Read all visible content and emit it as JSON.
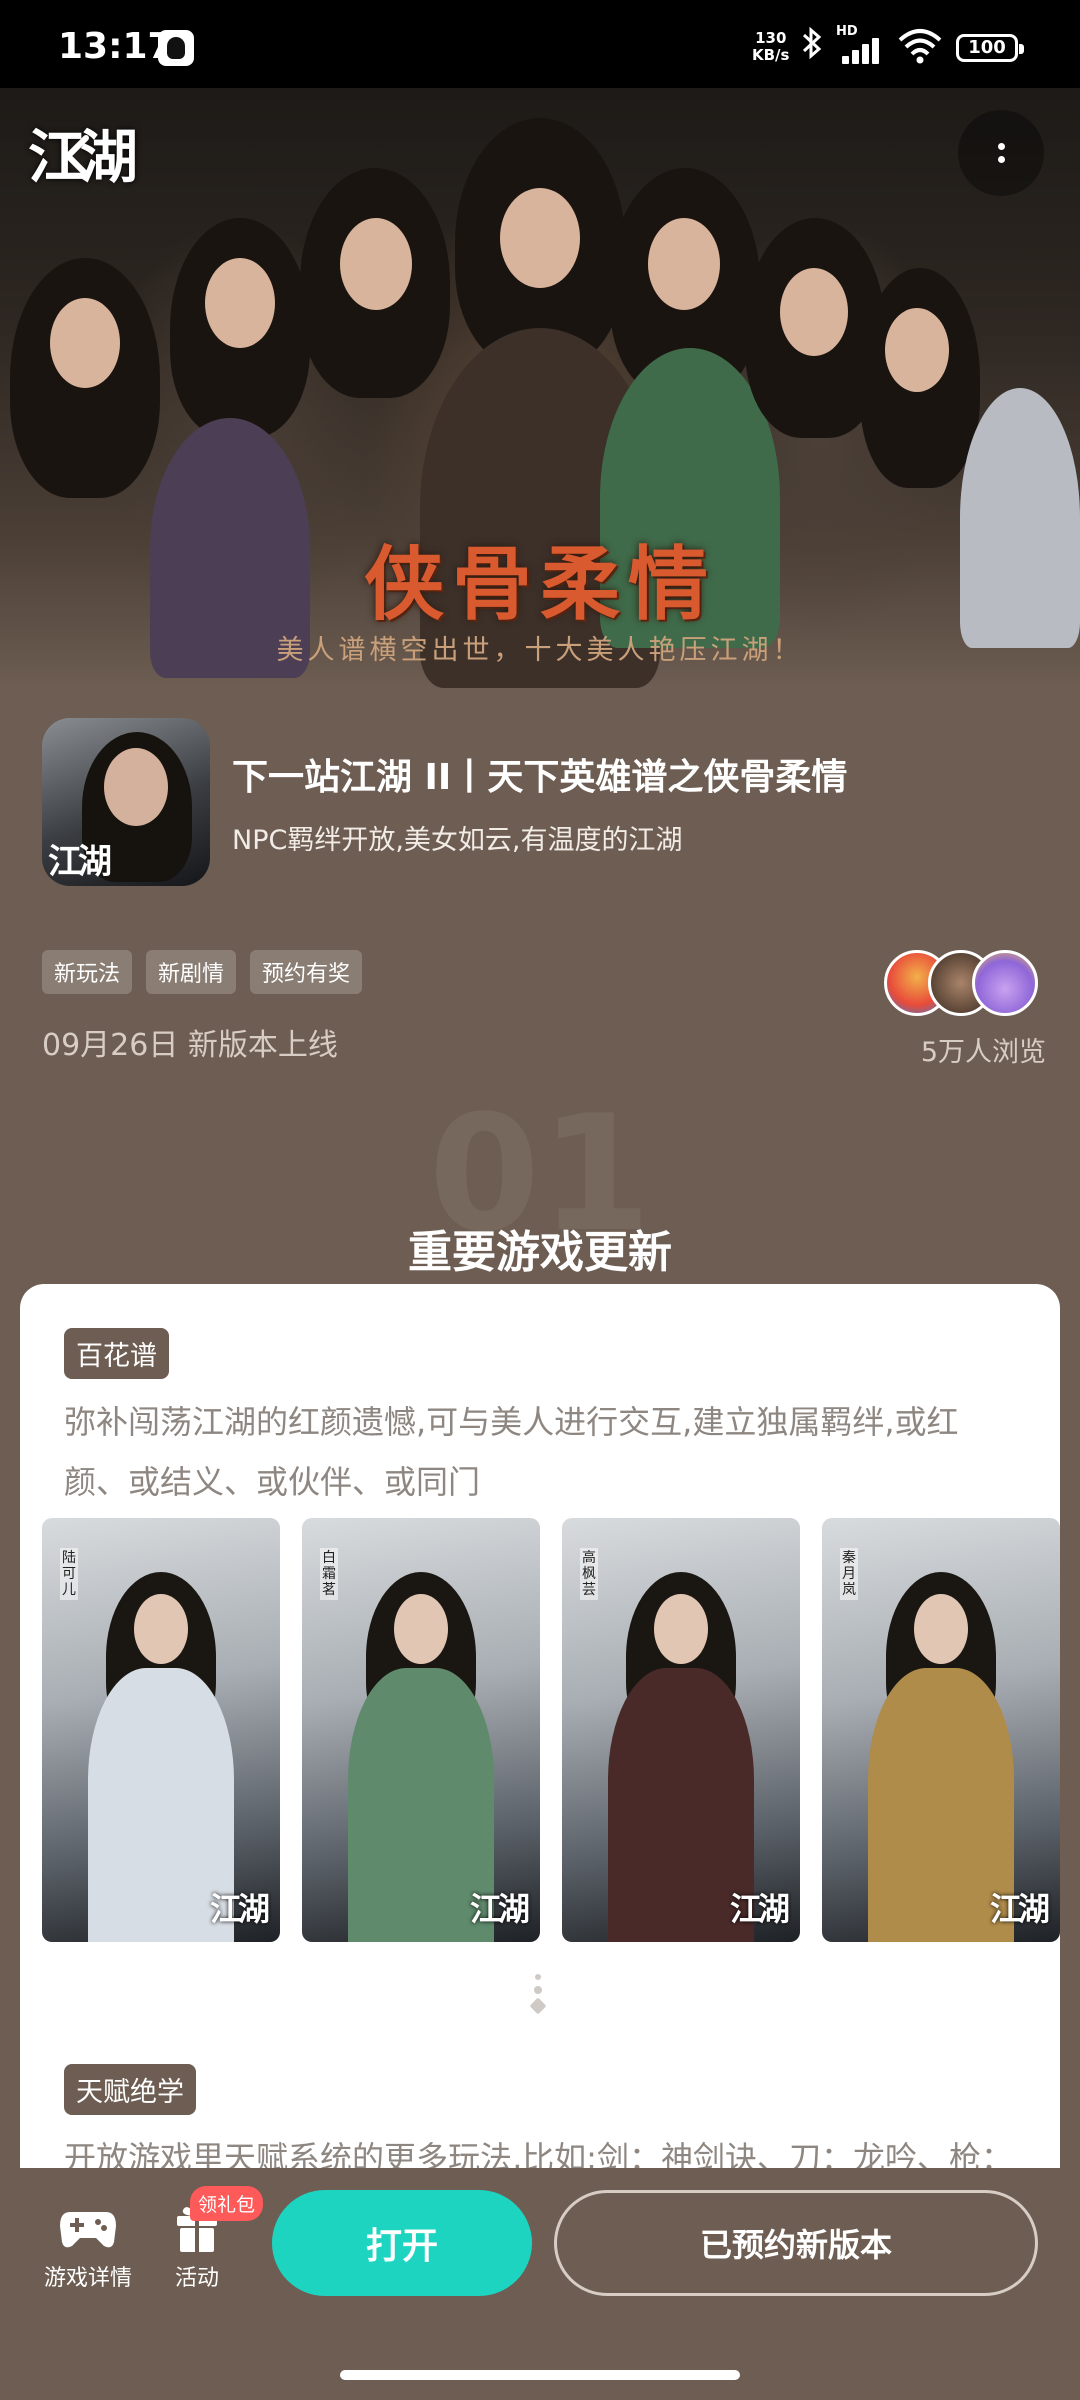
{
  "status_bar": {
    "time": "13:17",
    "net_speed_value": "130",
    "net_speed_unit": "KB/s",
    "network_label": "HD",
    "battery": "100"
  },
  "hero": {
    "logo_text": "江湖",
    "slogan": "侠骨柔情",
    "slogan_sub": "美人谱横空出世，十大美人艳压江湖！"
  },
  "game": {
    "icon_text": "江湖",
    "title": "下一站江湖 II丨天下英雄谱之侠骨柔情",
    "subtitle": "NPC羁绊开放,美女如云,有温度的江湖",
    "tags": [
      "新玩法",
      "新剧情",
      "预约有奖"
    ],
    "release": "09月26日 新版本上线",
    "views": "5万人浏览"
  },
  "section": {
    "number": "01",
    "title": "重要游戏更新"
  },
  "card": {
    "feature1_badge": "百花谱",
    "feature1_desc": "弥补闯荡江湖的红颜遗憾,可与美人进行交互,建立独属羁绊,或红颜、或结义、或伙伴、或同门",
    "thumbnails": [
      {
        "name": "陆可儿",
        "logo": "江湖"
      },
      {
        "name": "白霜茗",
        "logo": "江湖"
      },
      {
        "name": "高枫芸",
        "logo": "江湖"
      },
      {
        "name": "秦月岚",
        "logo": "江湖"
      }
    ],
    "feature2_badge": "天赋绝学",
    "feature2_desc": "开放游戏里天赋系统的更多玩法,比如:剑：神剑诀、刀：龙吟、枪："
  },
  "bottom_bar": {
    "details_label": "游戏详情",
    "activity_label": "活动",
    "gift_badge": "领礼包",
    "open_label": "打开",
    "reserved_label": "已预约新版本"
  },
  "colors": {
    "page_bg": "#6d5d52",
    "accent_teal": "#1dd4c0",
    "badge_red": "#ff5a5a"
  }
}
